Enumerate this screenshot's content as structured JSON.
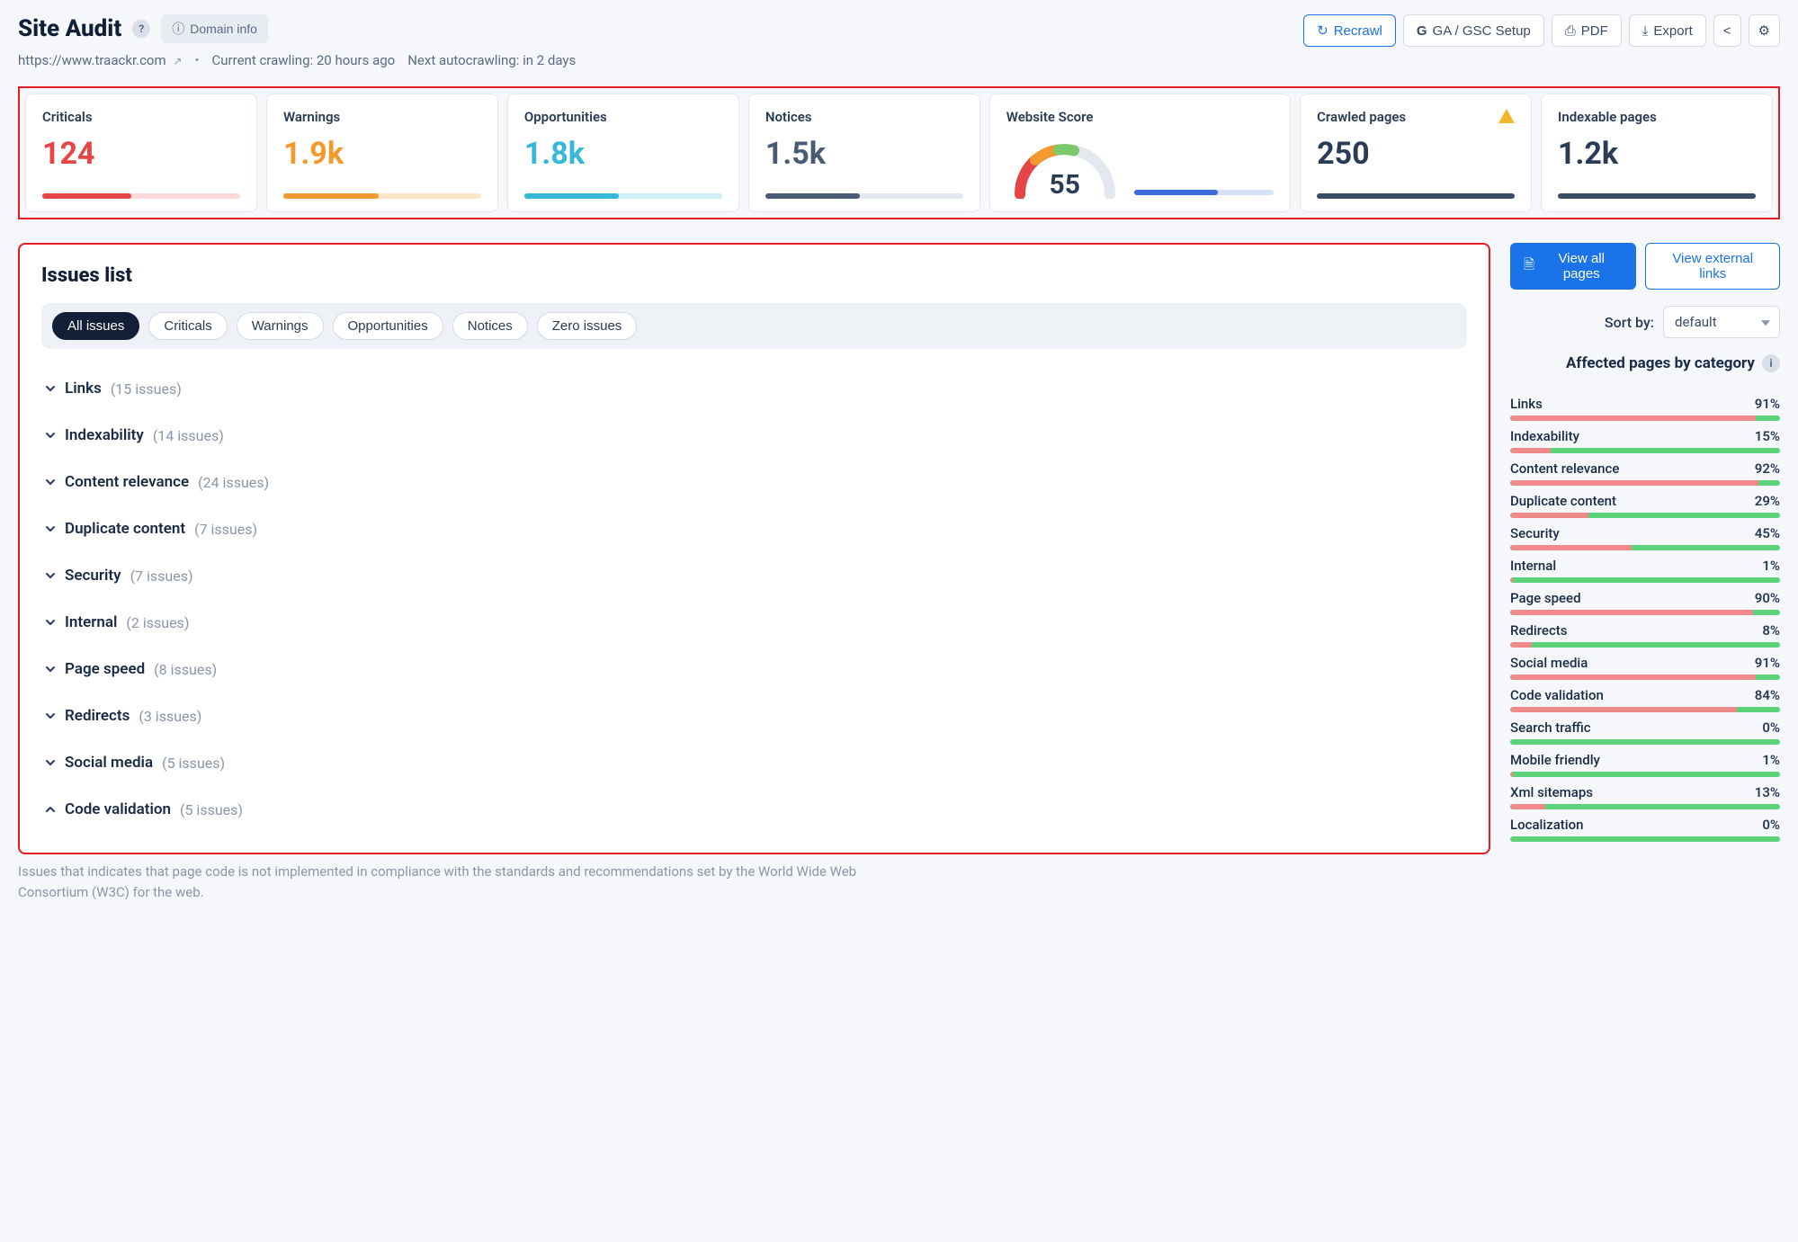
{
  "header": {
    "title": "Site Audit",
    "domain_info_label": "Domain info",
    "url": "https://www.traackr.com",
    "crawling_label": "Current crawling: 20 hours ago",
    "autocrawling_label": "Next autocrawling: in 2 days",
    "actions": {
      "recrawl": "Recrawl",
      "gagsc": "GA / GSC Setup",
      "pdf": "PDF",
      "export": "Export"
    }
  },
  "metrics": {
    "criticals": {
      "label": "Criticals",
      "value": "124",
      "fill": 45
    },
    "warnings": {
      "label": "Warnings",
      "value": "1.9k",
      "fill": 48
    },
    "opportunities": {
      "label": "Opportunities",
      "value": "1.8k",
      "fill": 48
    },
    "notices": {
      "label": "Notices",
      "value": "1.5k",
      "fill": 48
    },
    "score": {
      "label": "Website Score",
      "value": "55",
      "mini_fill": 60
    },
    "crawled": {
      "label": "Crawled pages",
      "value": "250",
      "fill": 100
    },
    "indexable": {
      "label": "Indexable pages",
      "value": "1.2k",
      "fill": 100
    }
  },
  "issues": {
    "title": "Issues list",
    "filters": {
      "all": "All issues",
      "criticals": "Criticals",
      "warnings": "Warnings",
      "opportunities": "Opportunities",
      "notices": "Notices",
      "zero": "Zero issues"
    },
    "categories": [
      {
        "name": "Links",
        "count": "(15 issues)",
        "expanded": false
      },
      {
        "name": "Indexability",
        "count": "(14 issues)",
        "expanded": false
      },
      {
        "name": "Content relevance",
        "count": "(24 issues)",
        "expanded": false
      },
      {
        "name": "Duplicate content",
        "count": "(7 issues)",
        "expanded": false
      },
      {
        "name": "Security",
        "count": "(7 issues)",
        "expanded": false
      },
      {
        "name": "Internal",
        "count": "(2 issues)",
        "expanded": false
      },
      {
        "name": "Page speed",
        "count": "(8 issues)",
        "expanded": false
      },
      {
        "name": "Redirects",
        "count": "(3 issues)",
        "expanded": false
      },
      {
        "name": "Social media",
        "count": "(5 issues)",
        "expanded": false
      },
      {
        "name": "Code validation",
        "count": "(5 issues)",
        "expanded": true
      }
    ],
    "footnote": "Issues that indicates that page code is not implemented in compliance with the standards and recommendations set by the World Wide Web Consortium (W3C) for the web."
  },
  "right": {
    "view_all_pages": "View all pages",
    "view_external": "View external links",
    "sortby_label": "Sort by:",
    "sortby_value": "default",
    "affected_title": "Affected pages by category",
    "categories": [
      {
        "name": "Links",
        "pct": "91%",
        "fill": 91
      },
      {
        "name": "Indexability",
        "pct": "15%",
        "fill": 15
      },
      {
        "name": "Content relevance",
        "pct": "92%",
        "fill": 92
      },
      {
        "name": "Duplicate content",
        "pct": "29%",
        "fill": 29
      },
      {
        "name": "Security",
        "pct": "45%",
        "fill": 45
      },
      {
        "name": "Internal",
        "pct": "1%",
        "fill": 1
      },
      {
        "name": "Page speed",
        "pct": "90%",
        "fill": 90
      },
      {
        "name": "Redirects",
        "pct": "8%",
        "fill": 8
      },
      {
        "name": "Social media",
        "pct": "91%",
        "fill": 91
      },
      {
        "name": "Code validation",
        "pct": "84%",
        "fill": 84
      },
      {
        "name": "Search traffic",
        "pct": "0%",
        "fill": 0
      },
      {
        "name": "Mobile friendly",
        "pct": "1%",
        "fill": 1
      },
      {
        "name": "Xml sitemaps",
        "pct": "13%",
        "fill": 13
      },
      {
        "name": "Localization",
        "pct": "0%",
        "fill": 0
      }
    ]
  }
}
